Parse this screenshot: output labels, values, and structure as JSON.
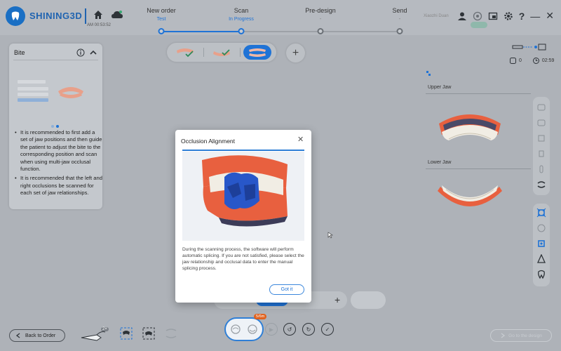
{
  "app": {
    "brand": "SHINING3D",
    "clock": "AM 00:53:52",
    "user_name": "Xiaozhi Duan"
  },
  "steps": [
    {
      "name": "New order",
      "status": "Test",
      "state": "active"
    },
    {
      "name": "Scan",
      "status": "In Progress",
      "state": "active"
    },
    {
      "name": "Pre-design",
      "status": "-",
      "state": "muted"
    },
    {
      "name": "Send",
      "status": "-",
      "state": "muted"
    }
  ],
  "bite_panel": {
    "title": "Bite",
    "tips": [
      "It is recommended to first add a set of jaw positions and then guide the patient to adjust the bite to the corresponding position and scan when using multi-jaw occlusal function.",
      "It is recommended that the left and right occlusions be scanned for each set of jaw relationships."
    ]
  },
  "right_panel": {
    "counter": "0",
    "timer": "02:59",
    "upper_jaw": "Upper Jaw",
    "lower_jaw": "Lower Jaw"
  },
  "dialog": {
    "title": "Occlusion Alignment",
    "body": "During the scanning process, the software will perform automatic splicing. If you are not satisfied, please select the jaw relationship and occlusal data to enter the manual splicing process.",
    "button": "Got it",
    "progress": 1.0
  },
  "bottom": {
    "back_label": "Back to Order",
    "design_label": "Go to the design",
    "scan_badge": "5/6m",
    "zoom_badge": "2×"
  },
  "colors": {
    "accent": "#1f73d6",
    "gum": "#e8603f",
    "bite_reg": "#2857c9"
  }
}
